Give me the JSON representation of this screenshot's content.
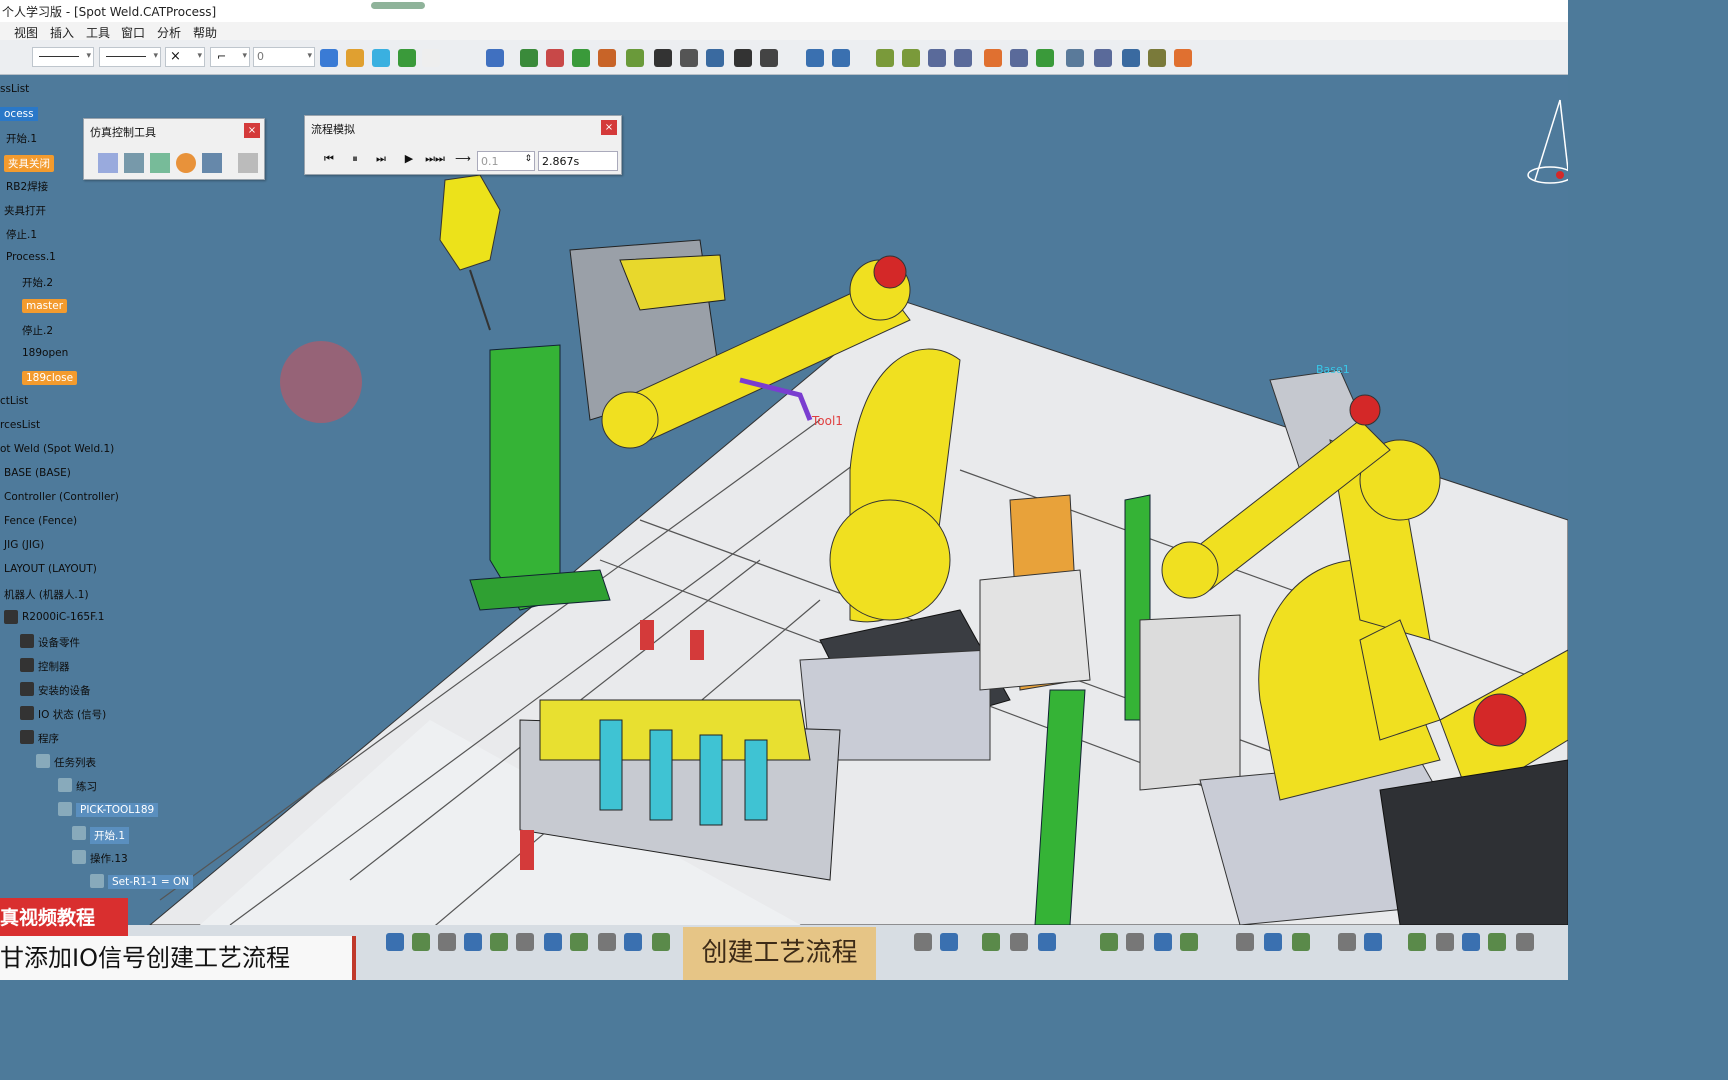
{
  "window": {
    "title": "个人学习版 - [Spot Weld.CATProcess]"
  },
  "menu": [
    "视图",
    "插入",
    "工具",
    "窗口",
    "分析",
    "帮助"
  ],
  "toolbar": {
    "combo_value": "0"
  },
  "sim_tool_panel": {
    "title": "仿真控制工具",
    "close": "×"
  },
  "process_sim_panel": {
    "title": "流程模拟",
    "close": "×",
    "step": "0.1",
    "time": "2.867s",
    "buttons": [
      "⏮",
      "⏸",
      "⏭",
      "▶",
      "⏭⏭",
      "⟶"
    ]
  },
  "tree": [
    {
      "label": "ssList",
      "style": "plain"
    },
    {
      "label": "ocess",
      "style": "sel"
    },
    {
      "label": "开始.1",
      "style": "plain"
    },
    {
      "label": "夹具关闭",
      "style": "hl"
    },
    {
      "label": "RB2焊接",
      "style": "plain"
    },
    {
      "label": "夹具打开",
      "style": "plain"
    },
    {
      "label": "停止.1",
      "style": "plain"
    },
    {
      "label": "Process.1",
      "style": "plain"
    },
    {
      "label": "开始.2",
      "style": "plain"
    },
    {
      "label": "master",
      "style": "hl"
    },
    {
      "label": "停止.2",
      "style": "plain"
    },
    {
      "label": "189open",
      "style": "plain"
    },
    {
      "label": "189close",
      "style": "hl"
    },
    {
      "label": "ctList",
      "style": "plain"
    },
    {
      "label": "rcesList",
      "style": "plain"
    },
    {
      "label": "ot Weld (Spot Weld.1)",
      "style": "plain"
    },
    {
      "label": "BASE (BASE)",
      "style": "plain"
    },
    {
      "label": "Controller (Controller)",
      "style": "plain"
    },
    {
      "label": "Fence (Fence)",
      "style": "plain"
    },
    {
      "label": "JIG (JIG)",
      "style": "plain"
    },
    {
      "label": "LAYOUT (LAYOUT)",
      "style": "plain"
    },
    {
      "label": "机器人 (机器人.1)",
      "style": "plain"
    },
    {
      "label": "R2000iC-165F.1",
      "style": "plain"
    },
    {
      "label": "设备零件",
      "style": "plain"
    },
    {
      "label": "控制器",
      "style": "plain"
    },
    {
      "label": "安装的设备",
      "style": "plain"
    },
    {
      "label": "IO 状态 (信号)",
      "style": "plain"
    },
    {
      "label": "程序",
      "style": "plain"
    },
    {
      "label": "任务列表",
      "style": "plain"
    },
    {
      "label": "练习",
      "style": "plain"
    },
    {
      "label": "PICK-TOOL189",
      "style": "blu"
    },
    {
      "label": "开始.1",
      "style": "blu"
    },
    {
      "label": "操作.13",
      "style": "plain"
    },
    {
      "label": "Set-R1-1 = ON",
      "style": "blu"
    }
  ],
  "scene_labels": {
    "tool1": "Tool1",
    "base1": "Base1"
  },
  "overlays": {
    "red_banner": "真视频教程",
    "white_banner": "甘添加IO信号创建工艺流程",
    "center_banner": "创建工艺流程"
  },
  "colors": {
    "viewport": "#4e7a9b",
    "robot": "#f0e020",
    "fixture": "#38b23a",
    "highlight": "#f39b2e"
  }
}
